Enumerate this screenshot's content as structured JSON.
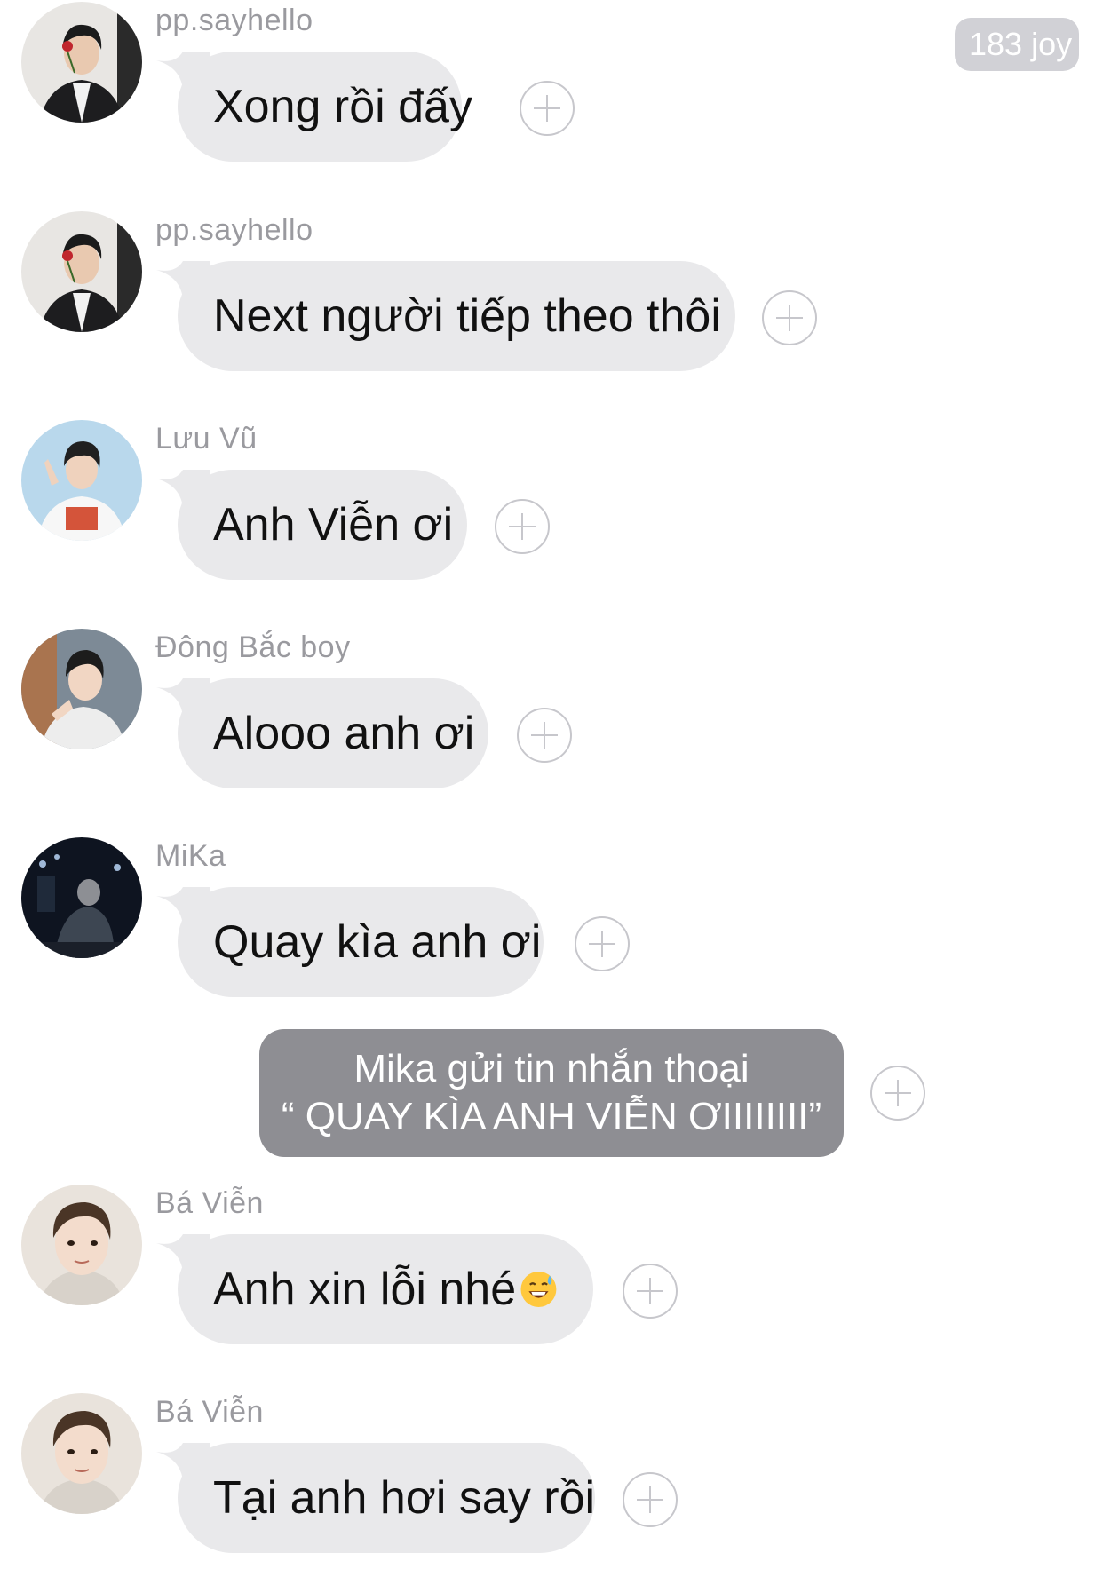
{
  "badge": {
    "label": "183 joy"
  },
  "messages": [
    {
      "sender": "pp.sayhello",
      "text": "Xong rồi đấy",
      "avatar": "avatar-boy-rose"
    },
    {
      "sender": "pp.sayhello",
      "text": "Next người tiếp theo thôi",
      "avatar": "avatar-boy-rose"
    },
    {
      "sender": "Lưu Vũ",
      "text": "Anh Viễn ơi",
      "avatar": "avatar-boy-peace"
    },
    {
      "sender": "Đông Bắc boy",
      "text": "Alooo anh ơi",
      "avatar": "avatar-boy-street"
    },
    {
      "sender": "MiKa",
      "text": "Quay kìa anh ơi",
      "avatar": "avatar-boy-stage"
    },
    {
      "sender": "Bá Viễn",
      "text": "Anh xin lỗi nhé",
      "emoji": "sweat-smile-emoji",
      "avatar": "avatar-boy-portrait"
    },
    {
      "sender": "Bá Viễn",
      "text": "Tại anh hơi say rồi",
      "avatar": "avatar-boy-portrait"
    }
  ],
  "system_message": {
    "line1": "Mika gửi tin nhắn thoại",
    "line2": "“ QUAY KÌA ANH VIỄN ƠIIIIIIII”"
  },
  "colors": {
    "bubble": "#e9e9eb",
    "system_bubble": "#8e8e93",
    "sender": "#9a9a9f",
    "badge": "#d1d1d6"
  },
  "icons": {
    "add": "plus-circle-icon"
  }
}
